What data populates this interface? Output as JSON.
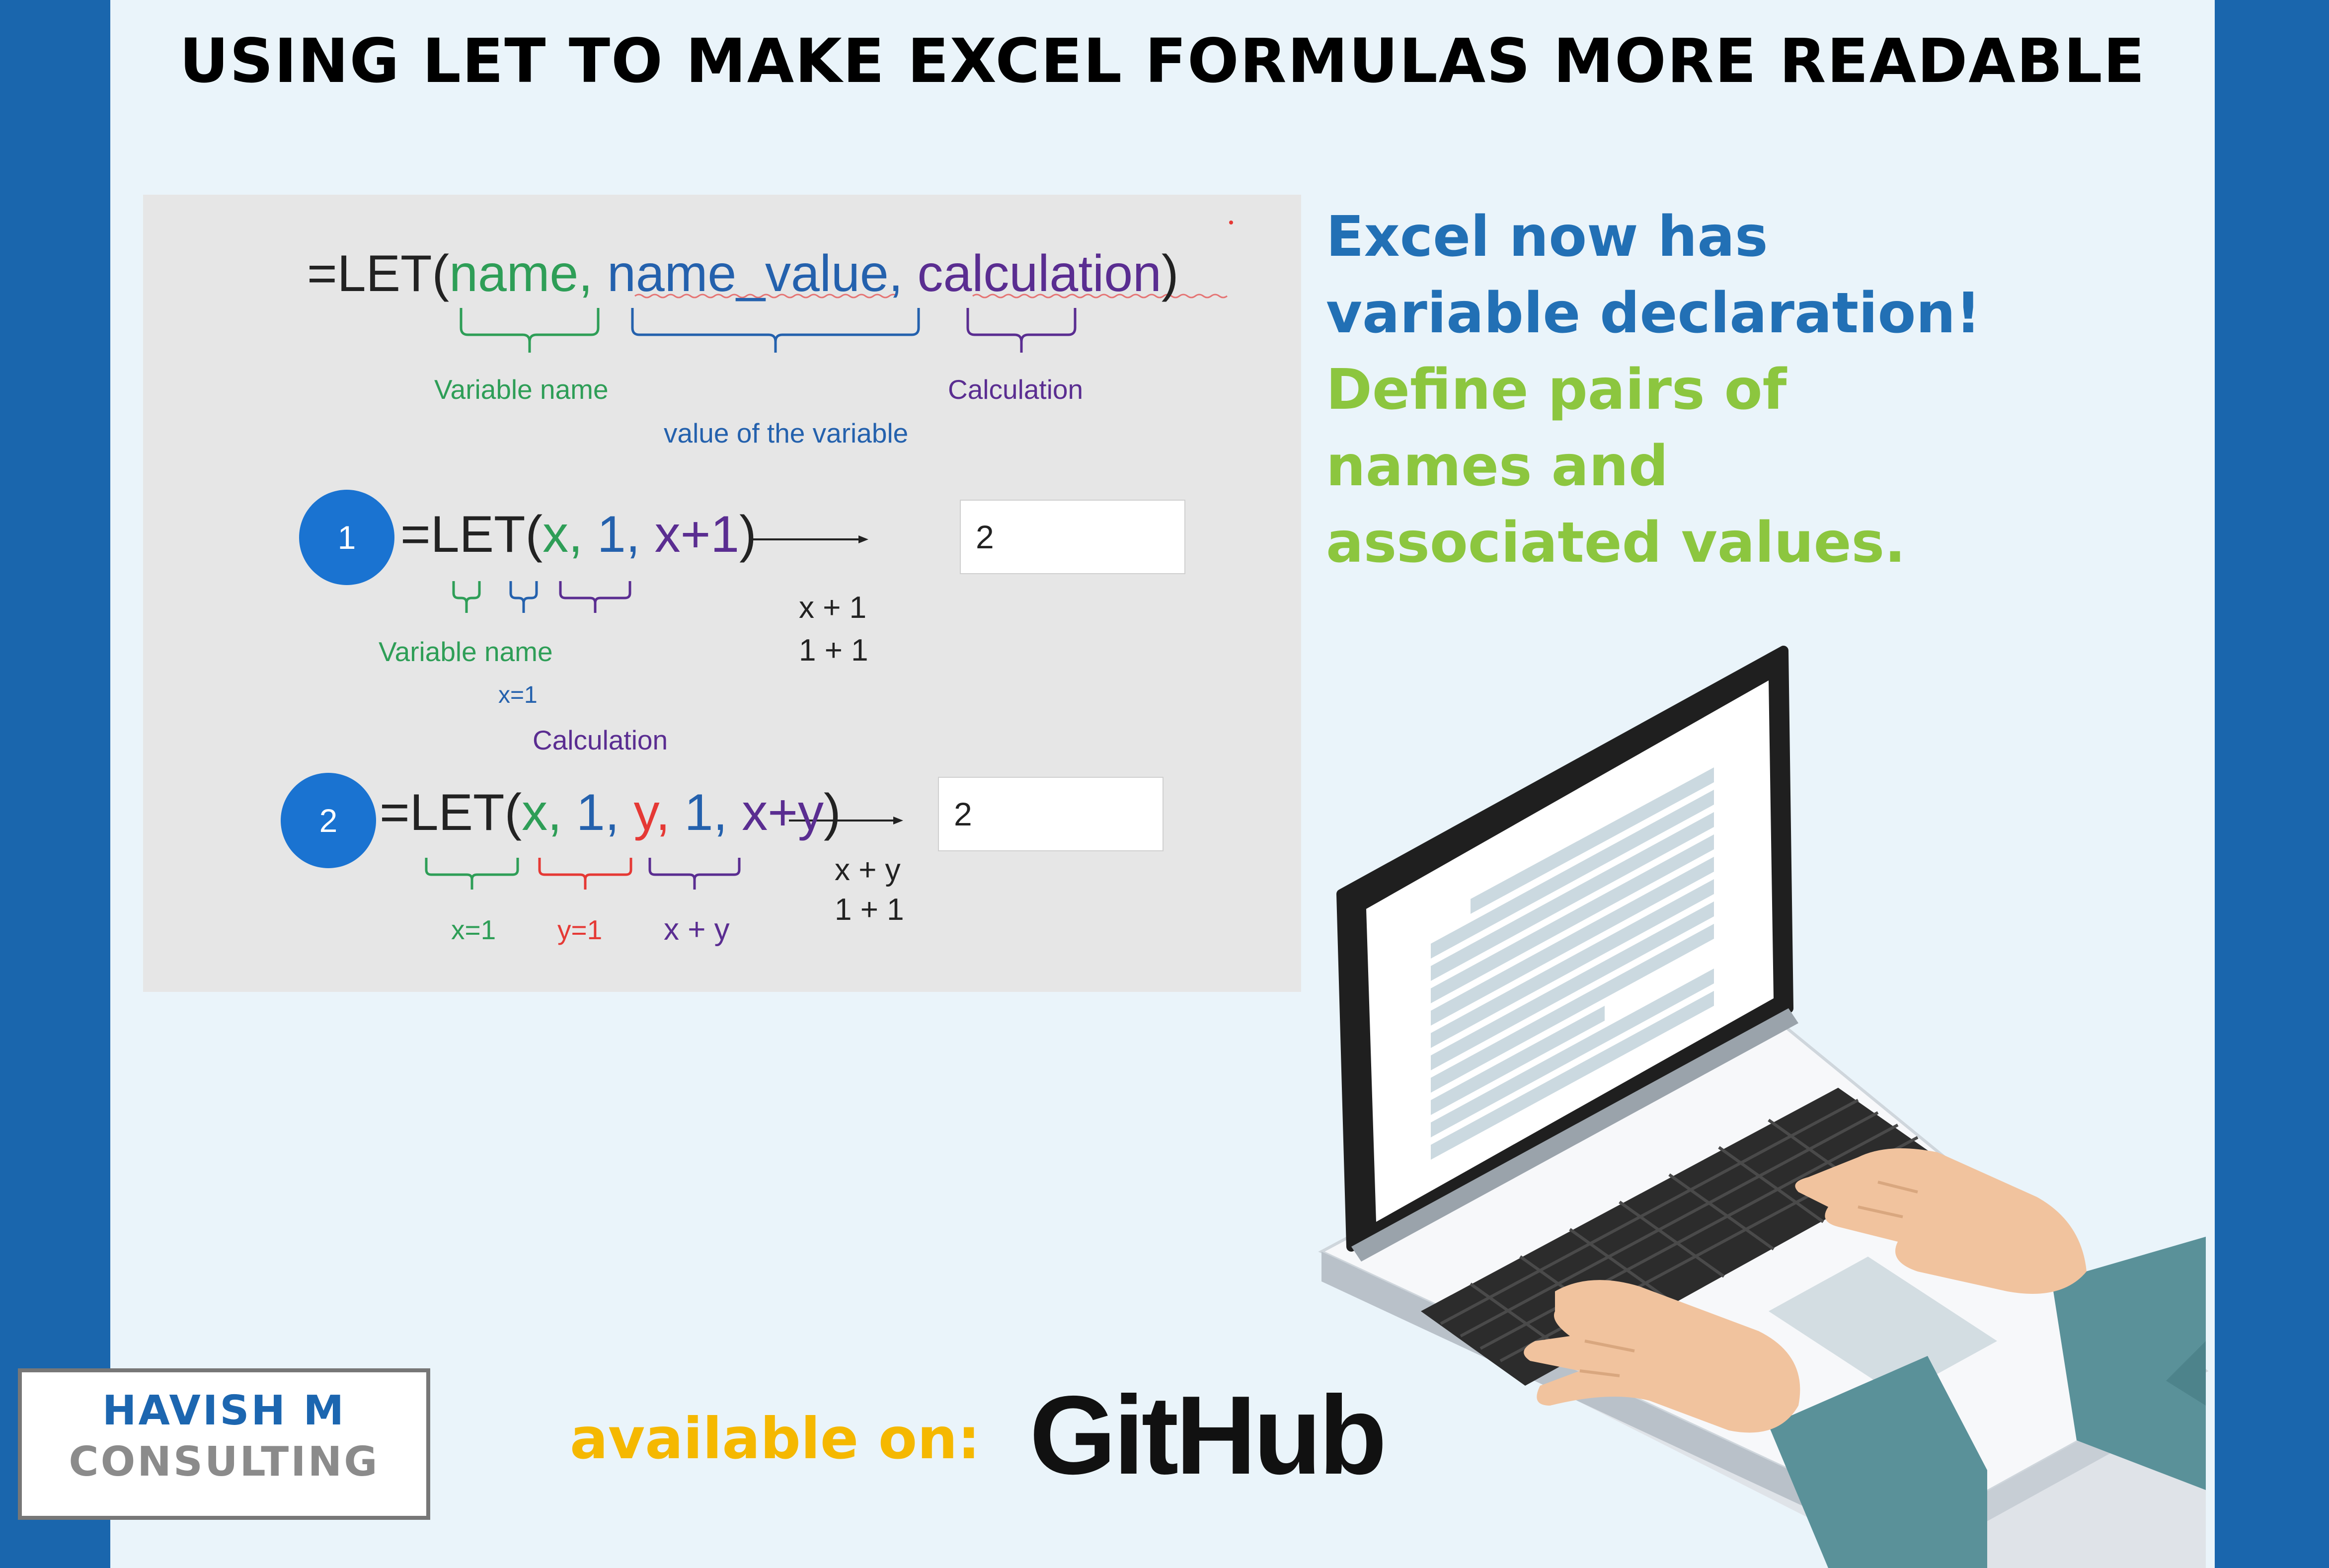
{
  "title": "USING LET TO MAKE EXCEL FORMULAS MORE READABLE",
  "diagram": {
    "syntax": {
      "eq": "=LET(",
      "name": "name,",
      "name_value": "name_value,",
      "calculation": "calculation",
      "close": ")",
      "label_name": "Variable name",
      "label_value": "value of the variable",
      "label_calc": "Calculation"
    },
    "example1": {
      "badge": "1",
      "eq": "=LET(",
      "x": "x,",
      "one": "1,",
      "calc": "x+1",
      "close": ")",
      "result": "2",
      "step1": "x + 1",
      "step2": "1 + 1",
      "label_name": "Variable name",
      "label_value": "x=1",
      "label_calc": "Calculation"
    },
    "example2": {
      "badge": "2",
      "eq": "=LET(",
      "x": "x,",
      "one_a": "1,",
      "y": "y,",
      "one_b": "1,",
      "calc": "x+y",
      "close": ")",
      "result": "2",
      "step1": "x + y",
      "step2": "1 + 1",
      "label_x": "x=1",
      "label_y": "y=1",
      "label_calc": "x + y"
    }
  },
  "side_text": {
    "line1": "Excel now has",
    "line2": "variable declaration!",
    "line3": "Define pairs of",
    "line4": "names and",
    "line5": "associated values."
  },
  "logo": {
    "line1": "HAVISH M",
    "line2": "CONSULTING"
  },
  "available_on": "available on:",
  "github": "GitHub",
  "colors": {
    "frame_blue": "#1a66ad",
    "heading_blue": "#2270b5",
    "accent_green": "#8cc63f",
    "available_yellow": "#f5b800",
    "badge_blue": "#1a73d1"
  },
  "icons": {
    "laptop": "laptop-illustration"
  }
}
